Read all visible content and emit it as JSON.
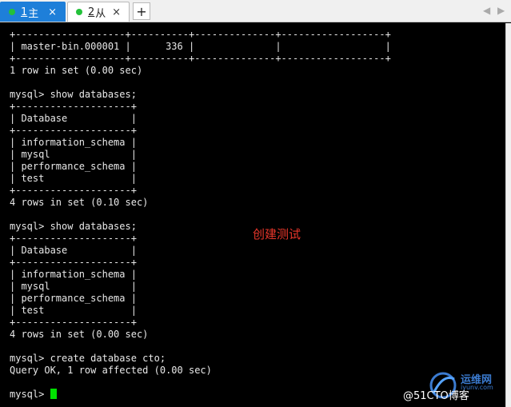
{
  "tabs": [
    {
      "number": "1",
      "label": "主",
      "close": "×",
      "active": true
    },
    {
      "number": "2",
      "label": "从",
      "close": "×",
      "active": false
    }
  ],
  "tab_add": "+",
  "tab_scroll": {
    "left": "◀",
    "right": "▶"
  },
  "terminal": {
    "lines": [
      "+-------------------+----------+--------------+------------------+",
      "| master-bin.000001 |      336 |              |                  |",
      "+-------------------+----------+--------------+------------------+",
      "1 row in set (0.00 sec)",
      "",
      "mysql> show databases;",
      "+--------------------+",
      "| Database           |",
      "+--------------------+",
      "| information_schema |",
      "| mysql              |",
      "| performance_schema |",
      "| test               |",
      "+--------------------+",
      "4 rows in set (0.10 sec)",
      "",
      "mysql> show databases;",
      "+--------------------+",
      "| Database           |",
      "+--------------------+",
      "| information_schema |",
      "| mysql              |",
      "| performance_schema |",
      "| test               |",
      "+--------------------+",
      "4 rows in set (0.00 sec)",
      "",
      "mysql> create database cto;",
      "Query OK, 1 row affected (0.00 sec)",
      ""
    ],
    "prompt": "mysql> ",
    "cursor_color": "#00e000",
    "text_color": "#e8e8e8",
    "background": "#000000"
  },
  "annotation": {
    "text": "创建测试",
    "color": "#e8362a"
  },
  "watermark": {
    "site_cn": "运维网",
    "site_en": "iyunv.com",
    "credit": "@51CTO博客"
  },
  "colors": {
    "active_tab": "#1e7fd9",
    "status_dot": "#23c13a"
  }
}
